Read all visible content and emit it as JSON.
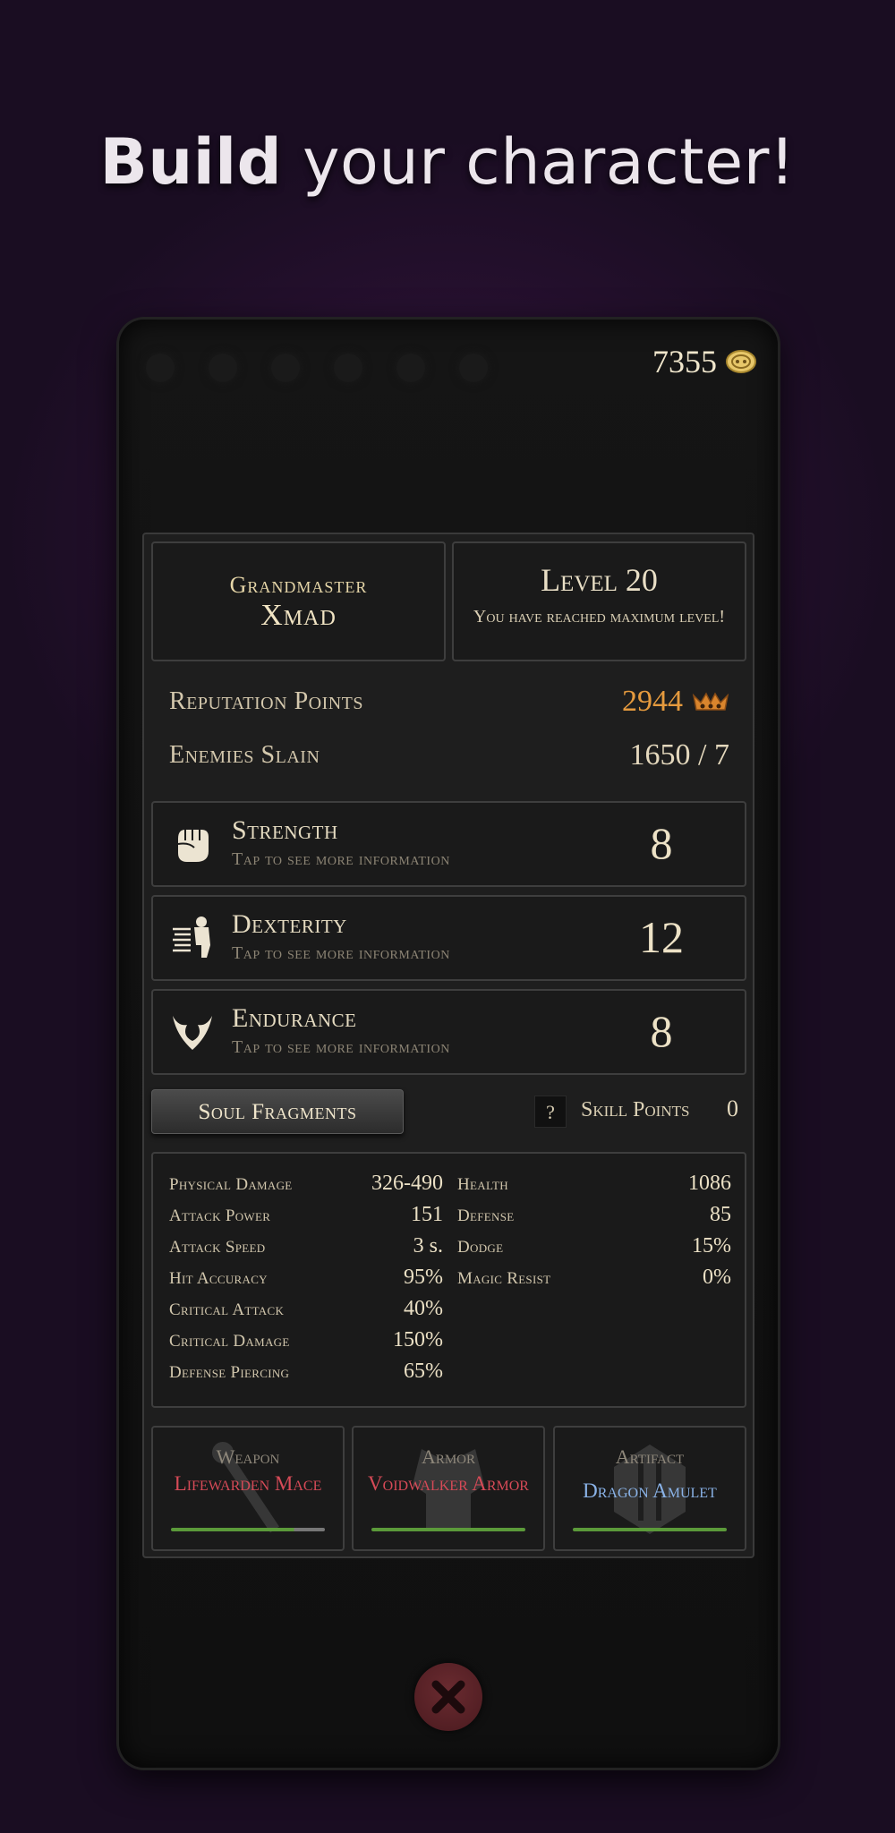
{
  "headline": {
    "bold": "Build",
    "rest": "your character!"
  },
  "currency": {
    "value": "7355",
    "icon": "coin-icon"
  },
  "profile": {
    "rank": "Grandmaster",
    "name": "Xmad",
    "level_title": "Level 20",
    "level_subtitle": "You have reached maximum level!"
  },
  "reputation": {
    "label": "Reputation Points",
    "value": "2944",
    "icon": "crown-icon",
    "color": "#e59a3e"
  },
  "enemies": {
    "label": "Enemies Slain",
    "value": "1650 / 7"
  },
  "attributes": [
    {
      "name": "Strength",
      "hint": "Tap to see more information",
      "value": "8",
      "icon": "fist-icon"
    },
    {
      "name": "Dexterity",
      "hint": "Tap to see more information",
      "value": "12",
      "icon": "running-figure-icon"
    },
    {
      "name": "Endurance",
      "hint": "Tap to see more information",
      "value": "8",
      "icon": "winged-heart-icon"
    }
  ],
  "soul_fragments_label": "Soul Fragments",
  "help_label": "?",
  "skill_points": {
    "label": "Skill Points",
    "value": "0"
  },
  "offense_stats": [
    {
      "label": "Physical Damage",
      "value": "326-490"
    },
    {
      "label": "Attack Power",
      "value": "151"
    },
    {
      "label": "Attack Speed",
      "value": "3 s."
    },
    {
      "label": "Hit Accuracy",
      "value": "95%"
    },
    {
      "label": "Critical Attack",
      "value": "40%"
    },
    {
      "label": "Critical Damage",
      "value": "150%"
    },
    {
      "label": "Defense Piercing",
      "value": "65%"
    }
  ],
  "defense_stats": [
    {
      "label": "Health",
      "value": "1086"
    },
    {
      "label": "Defense",
      "value": "85"
    },
    {
      "label": "Dodge",
      "value": "15%"
    },
    {
      "label": "Magic Resist",
      "value": "0%"
    }
  ],
  "equipment": [
    {
      "type": "Weapon",
      "name": "Lifewarden Mace",
      "name_color": "#d64a57",
      "bar_color": "#5b9a3a"
    },
    {
      "type": "Armor",
      "name": "Voidwalker Armor",
      "name_color": "#d64a57",
      "bar_color": "#5b9a3a"
    },
    {
      "type": "Artifact",
      "name": "Dragon Amulet",
      "name_color": "#8ab3e8",
      "bar_color": "#5b9a3a"
    }
  ],
  "close_icon": "close-icon"
}
